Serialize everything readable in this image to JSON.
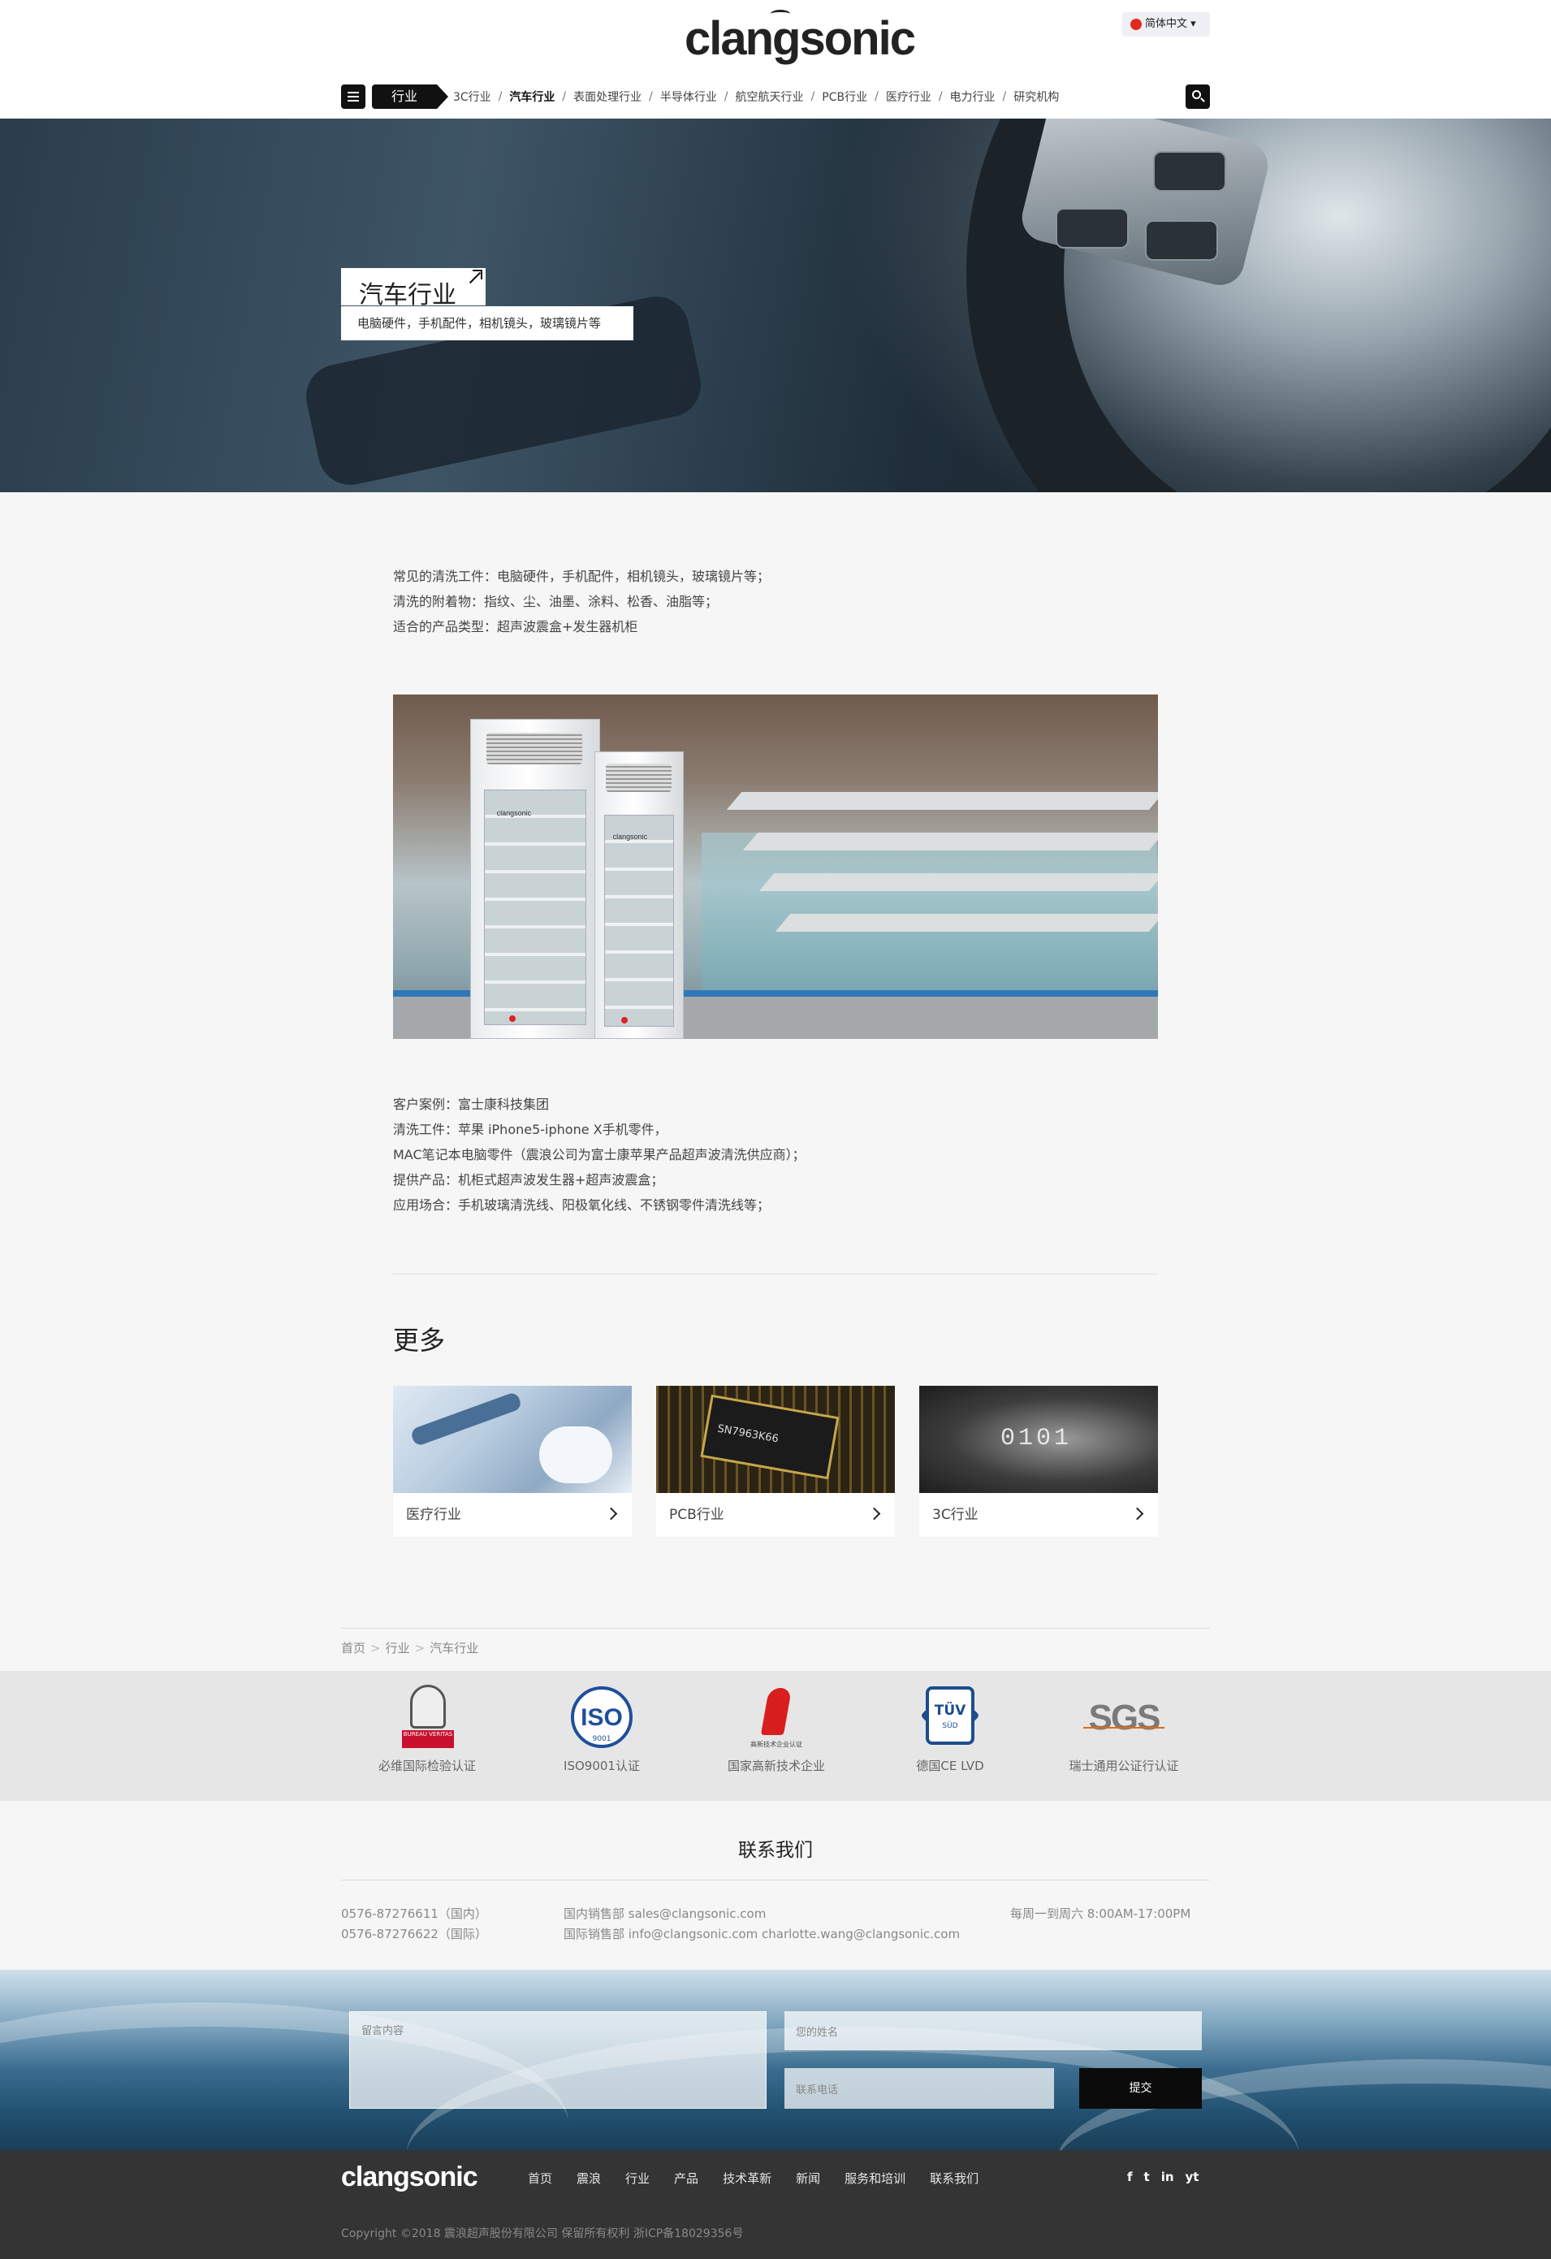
{
  "header": {
    "logo": "clangsonic",
    "language": "简体中文",
    "nav_current": "行业",
    "nav_items": [
      "3C行业",
      "汽车行业",
      "表面处理行业",
      "半导体行业",
      "航空航天行业",
      "PCB行业",
      "医疗行业",
      "电力行业",
      "研究机构"
    ],
    "active_item": "汽车行业"
  },
  "hero": {
    "title": "汽车行业",
    "subtitle": "电脑硬件，手机配件，相机镜头，玻璃镜片等"
  },
  "intro": [
    "常见的清洗工件：电脑硬件，手机配件，相机镜头，玻璃镜片等；",
    "清洗的附着物：指纹、尘、油墨、涂料、松香、油脂等；",
    "适合的产品类型：超声波震盒+发生器机柜"
  ],
  "photo": {
    "cabinet_brand": "clangsonic"
  },
  "case": [
    "客户案例：富士康科技集团",
    "清洗工件：苹果 iPhone5-iphone X手机零件，",
    "MAC笔记本电脑零件（震浪公司为富士康苹果产品超声波清洗供应商）；",
    "提供产品：机柜式超声波发生器+超声波震盒；",
    "应用场合：手机玻璃清洗线、阳极氧化线、不锈钢零件清洗线等；"
  ],
  "more": {
    "title": "更多",
    "cards": [
      {
        "label": "医疗行业"
      },
      {
        "label": "PCB行业",
        "chip_text": "SN7963K66"
      },
      {
        "label": "3C行业",
        "digits": "0101"
      }
    ]
  },
  "breadcrumb": [
    "首页",
    "行业",
    "汽车行业"
  ],
  "certs": [
    {
      "caption": "必维国际检验认证",
      "badge_text": "BUREAU VERITAS"
    },
    {
      "caption": "ISO9001认证",
      "badge_text": "ISO",
      "badge_sub": "9001"
    },
    {
      "caption": "国家高新技术企业",
      "badge_text": "高新技术企业认证"
    },
    {
      "caption": "德国CE LVD",
      "badge_text": "TÜV",
      "badge_sub": "SÜD"
    },
    {
      "caption": "瑞士通用公证行认证",
      "badge_text": "SGS"
    }
  ],
  "contact": {
    "title": "联系我们",
    "phones": [
      "0576-87276611（国内）",
      "0576-87276622（国际）"
    ],
    "emails": [
      "国内销售部 sales@clangsonic.com",
      "国际销售部 info@clangsonic.com charlotte.wang@clangsonic.com"
    ],
    "hours": "每周一到周六 8:00AM-17:00PM"
  },
  "form": {
    "message_placeholder": "留言内容",
    "name_placeholder": "您的姓名",
    "phone_placeholder": "联系电话",
    "submit": "提交"
  },
  "footer": {
    "logo": "clangsonic",
    "nav": [
      "首页",
      "震浪",
      "行业",
      "产品",
      "技术革新",
      "新闻",
      "服务和培训",
      "联系我们"
    ],
    "social": [
      "f",
      "t",
      "in",
      "yt"
    ],
    "copyright": "Copyright ©2018 震浪超声股份有限公司  保留所有权利  浙ICP备18029356号"
  },
  "colors": {
    "accent": "#111111",
    "flag": "#e02a20",
    "footer_bg": "#343434"
  }
}
